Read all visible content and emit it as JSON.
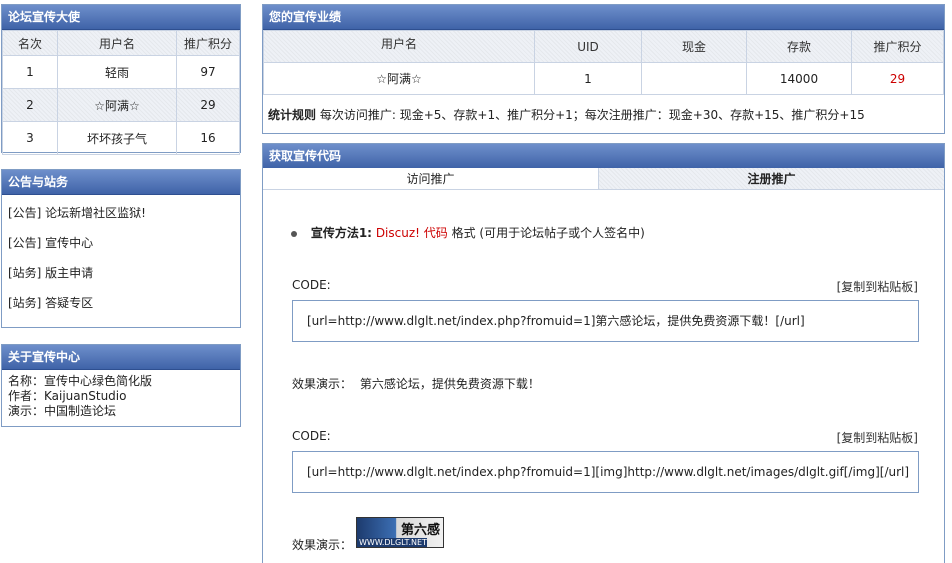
{
  "ambassadors": {
    "title": "论坛宣传大使",
    "headers": [
      "名次",
      "用户名",
      "推广积分"
    ],
    "rows": [
      {
        "rank": "1",
        "name": "轻雨",
        "score": "97"
      },
      {
        "rank": "2",
        "name": "☆阿满☆",
        "score": "29"
      },
      {
        "rank": "3",
        "name": "坏坏孩子气",
        "score": "16"
      }
    ]
  },
  "notices": {
    "title": "公告与站务",
    "items": [
      "[公告] 论坛新增社区监狱!",
      "[公告] 宣传中心",
      "[站务] 版主申请",
      "[站务] 答疑专区"
    ]
  },
  "about": {
    "title": "关于宣传中心",
    "lines": [
      "名称：宣传中心绿色简化版",
      "作者：KaijuanStudio",
      "演示：中国制造论坛"
    ]
  },
  "performance": {
    "title": "您的宣传业绩",
    "headers": [
      "用户名",
      "UID",
      "现金",
      "存款",
      "推广积分"
    ],
    "row": {
      "name": "☆阿满☆",
      "uid": "1",
      "cash": "",
      "deposit": "14000",
      "score": "29"
    },
    "rules_label": "统计规则",
    "rules_text": "每次访问推广: 现金+5、存款+1、推广积分+1；每次注册推广：现金+30、存款+15、推广积分+15"
  },
  "code": {
    "title": "获取宣传代码",
    "tabs": [
      "访问推广",
      "注册推广"
    ],
    "method_label": "宣传方法1:",
    "method_link": "Discuz! 代码",
    "method_rest": "格式 (可用于论坛帖子或个人签名中)",
    "code_label": "CODE:",
    "copy_label": "[复制到粘贴板]",
    "code1": "[url=http://www.dlglt.net/index.php?fromuid=1]第六感论坛，提供免费资源下载！[/url]",
    "demo_label": "效果演示：",
    "demo_text": "第六感论坛，提供免费资源下载！",
    "code2": "[url=http://www.dlglt.net/index.php?fromuid=1][img]http://www.dlglt.net/images/dlglt.gif[/img][/url]",
    "banner_text": "第六感",
    "banner_sub": "WWW.DLGLT.NET"
  }
}
